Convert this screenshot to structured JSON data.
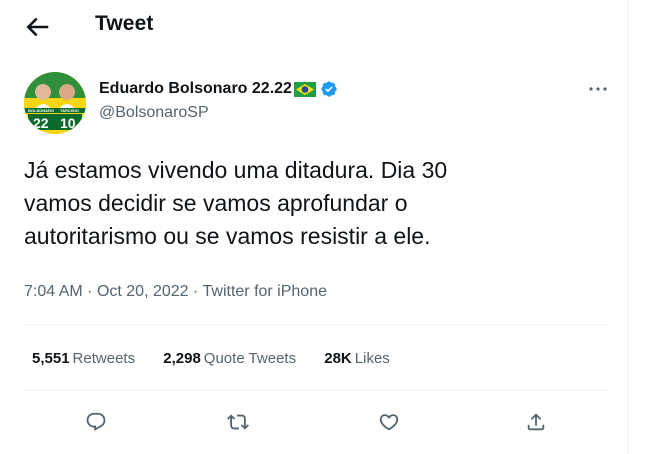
{
  "header": {
    "title": "Tweet",
    "back_icon": "arrow-left-icon"
  },
  "tweet": {
    "author": {
      "name": "Eduardo Bolsonaro 22.22",
      "handle": "@BolsonaroSP",
      "flag_icon": "brazil-flag-icon",
      "verified_icon": "verified-badge-icon",
      "avatar": {
        "label_left": "BOLSONARO",
        "label_right": "TARCISIO",
        "num_left": "22",
        "num_right": "10"
      }
    },
    "text_lines": [
      "Já estamos vivendo uma ditadura. Dia 30",
      "vamos decidir se vamos aprofundar o",
      "autoritarismo ou se vamos resistir a ele."
    ],
    "time": "7:04 AM",
    "date": "Oct 20, 2022",
    "separator": "·",
    "source": "Twitter for iPhone",
    "stats": {
      "retweets": {
        "count": "5,551",
        "label": "Retweets"
      },
      "quote_tweets": {
        "count": "2,298",
        "label": "Quote Tweets"
      },
      "likes": {
        "count": "28K",
        "label": "Likes"
      }
    }
  },
  "actions": [
    "reply-icon",
    "retweet-icon",
    "like-icon",
    "share-icon"
  ],
  "colors": {
    "accent": "#1d9bf0",
    "text": "#0f1419",
    "secondary": "#536471",
    "divider": "#eff3f4"
  }
}
